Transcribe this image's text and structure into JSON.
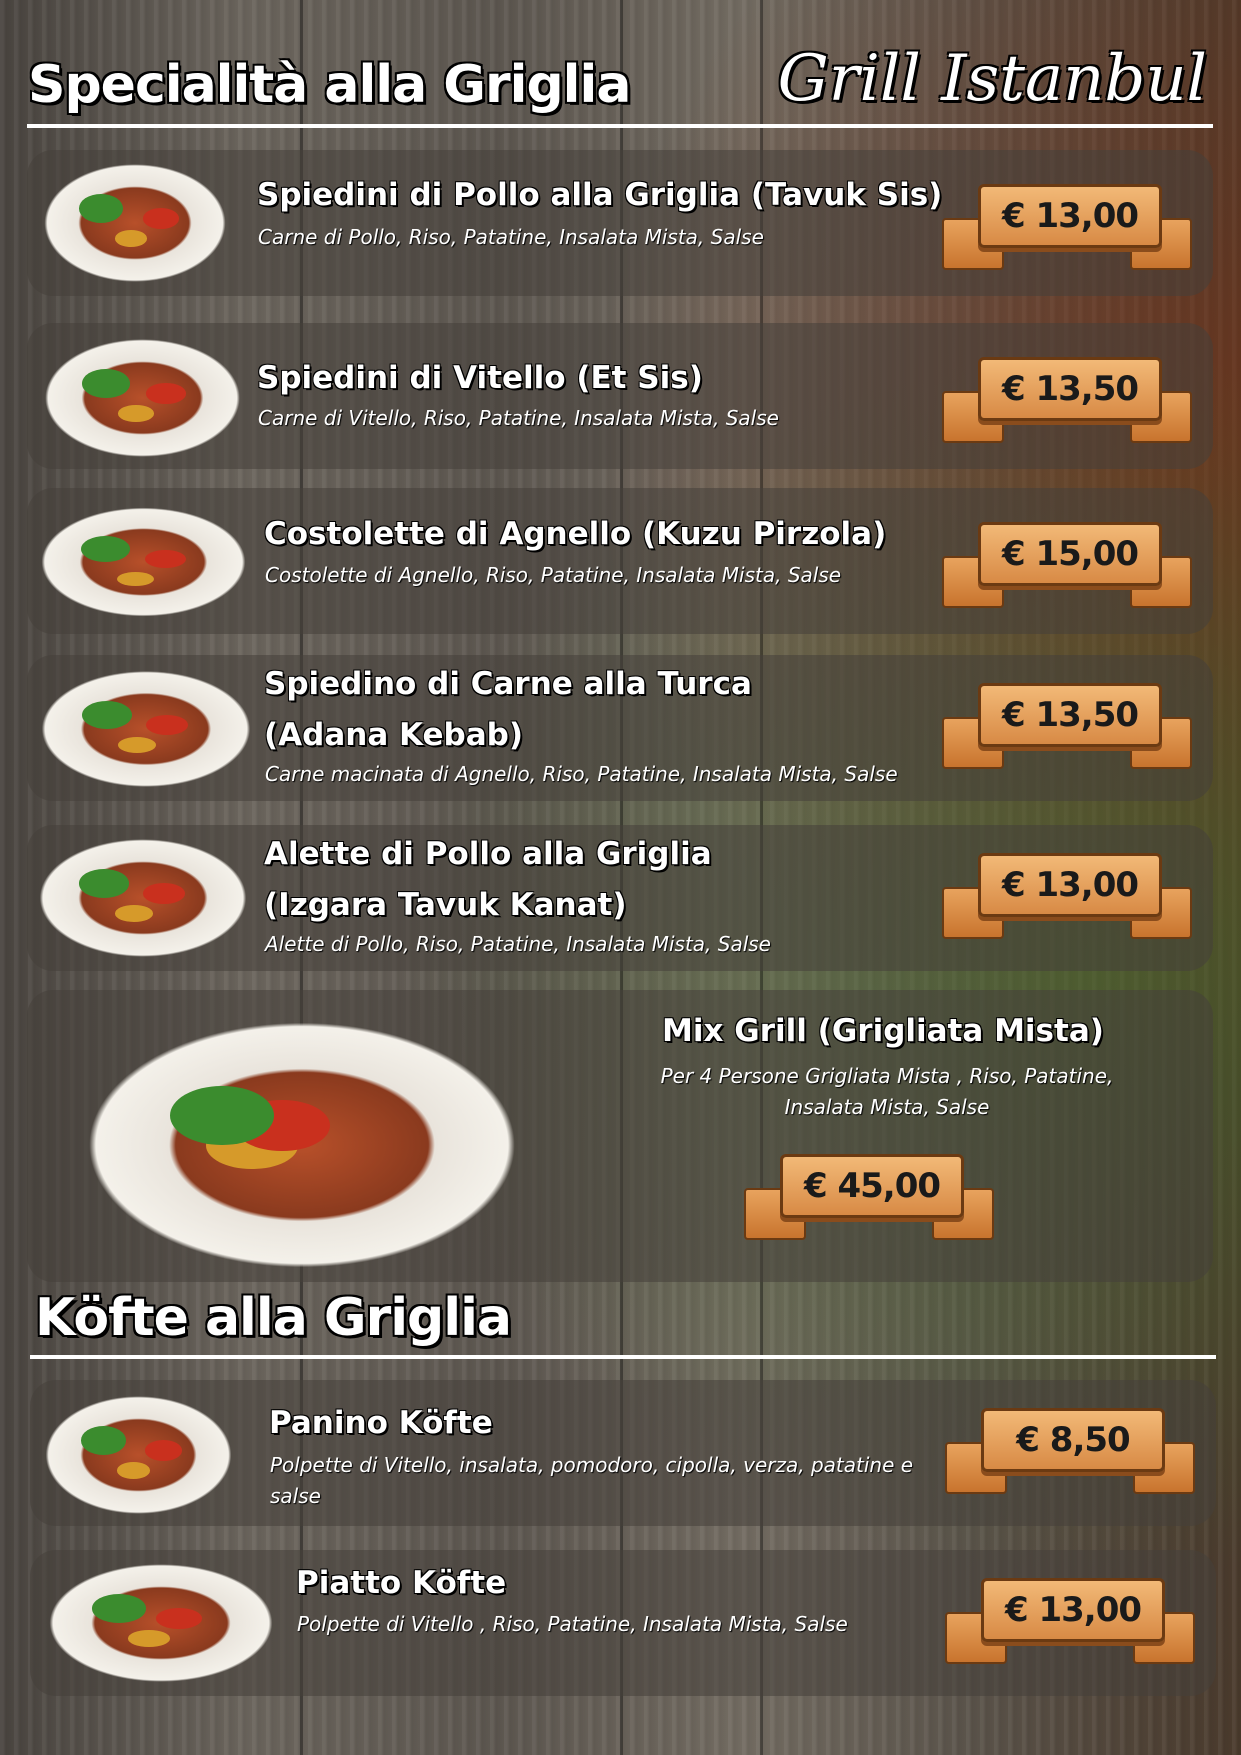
{
  "brand": "Grill Istanbul",
  "grill_section": {
    "title": "Specialità alla Griglia",
    "items": [
      {
        "name": "Spiedini di Pollo alla Griglia (Tavuk Sis)",
        "description": "Carne di Pollo, Riso, Patatine, Insalata Mista, Salse",
        "price": "€ 13,00"
      },
      {
        "name": "Spiedini di Vitello (Et Sis)",
        "description": "Carne di Vitello, Riso, Patatine, Insalata Mista, Salse",
        "price": "€ 13,50"
      },
      {
        "name": "Costolette di Agnello (Kuzu Pirzola)",
        "description": "Costolette di Agnello, Riso, Patatine, Insalata Mista, Salse",
        "price": "€ 15,00"
      },
      {
        "name_line1": "Spiedino di Carne alla Turca",
        "name_line2": "(Adana Kebab)",
        "description": "Carne macinata di Agnello, Riso, Patatine, Insalata Mista, Salse",
        "price": "€ 13,50"
      },
      {
        "name_line1": "Alette di Pollo alla Griglia",
        "name_line2": "(Izgara Tavuk Kanat)",
        "description": "Alette di Pollo, Riso, Patatine, Insalata Mista, Salse",
        "price": "€ 13,00"
      }
    ],
    "mix": {
      "name": "Mix Grill (Grigliata Mista)",
      "description_line1": "Per 4 Persone Grigliata Mista , Riso, Patatine,",
      "description_line2": "Insalata Mista, Salse",
      "price": "€ 45,00"
    }
  },
  "kofte_section": {
    "title": "Köfte alla Griglia",
    "items": [
      {
        "name": "Panino Köfte",
        "description_line1": "Polpette di Vitello, insalata, pomodoro, cipolla, verza, patatine e",
        "description_line2": "salse",
        "price": "€ 8,50"
      },
      {
        "name": "Piatto Köfte",
        "description": "Polpette di Vitello , Riso, Patatine, Insalata Mista, Salse",
        "price": "€ 13,00"
      }
    ]
  }
}
